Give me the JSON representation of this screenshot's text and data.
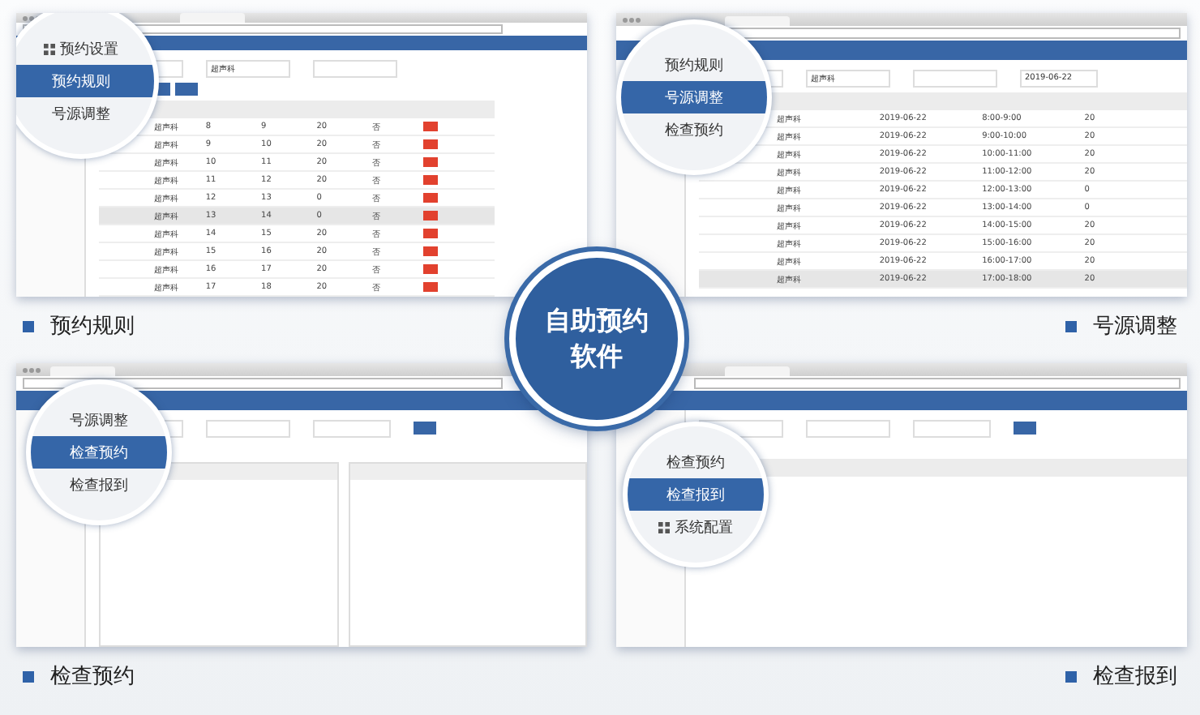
{
  "panels": [
    {
      "kind": "rules_table",
      "caption": "预约规则",
      "menu": [
        {
          "kind": "group",
          "label": "预约设置",
          "selected": false
        },
        {
          "kind": "item",
          "label": "预约规则",
          "selected": true
        },
        {
          "kind": "item",
          "label": "号源调整",
          "selected": false
        }
      ],
      "filters": [
        {
          "kind": "select"
        },
        {
          "kind": "select",
          "value": "超声科"
        },
        {
          "kind": "select"
        }
      ],
      "rows": [
        {
          "cells": [
            "超声科",
            "8",
            "9",
            "20",
            "否"
          ],
          "selected": false
        },
        {
          "cells": [
            "超声科",
            "9",
            "10",
            "20",
            "否"
          ],
          "selected": false
        },
        {
          "cells": [
            "超声科",
            "10",
            "11",
            "20",
            "否"
          ],
          "selected": false
        },
        {
          "cells": [
            "超声科",
            "11",
            "12",
            "20",
            "否"
          ],
          "selected": false
        },
        {
          "cells": [
            "超声科",
            "12",
            "13",
            "0",
            "否"
          ],
          "selected": false
        },
        {
          "cells": [
            "超声科",
            "13",
            "14",
            "0",
            "否"
          ],
          "selected": true
        },
        {
          "cells": [
            "超声科",
            "14",
            "15",
            "20",
            "否"
          ],
          "selected": false
        },
        {
          "cells": [
            "超声科",
            "15",
            "16",
            "20",
            "否"
          ],
          "selected": false
        },
        {
          "cells": [
            "超声科",
            "16",
            "17",
            "20",
            "否"
          ],
          "selected": false
        },
        {
          "cells": [
            "超声科",
            "17",
            "18",
            "20",
            "否"
          ],
          "selected": false
        }
      ]
    },
    {
      "kind": "slot_table",
      "caption": "号源调整",
      "menu": [
        {
          "kind": "item",
          "label": "预约规则",
          "selected": false
        },
        {
          "kind": "item",
          "label": "号源调整",
          "selected": true
        },
        {
          "kind": "item",
          "label": "检查预约",
          "selected": false
        }
      ],
      "filters": [
        {
          "kind": "select"
        },
        {
          "kind": "select",
          "value": "超声科"
        },
        {
          "kind": "select"
        },
        {
          "kind": "input",
          "value": "2019-06-22"
        }
      ],
      "rows": [
        {
          "cells": [
            "超声科",
            "2019-06-22",
            "8:00-9:00",
            "20"
          ],
          "selected": false
        },
        {
          "cells": [
            "超声科",
            "2019-06-22",
            "9:00-10:00",
            "20"
          ],
          "selected": false
        },
        {
          "cells": [
            "超声科",
            "2019-06-22",
            "10:00-11:00",
            "20"
          ],
          "selected": false
        },
        {
          "cells": [
            "超声科",
            "2019-06-22",
            "11:00-12:00",
            "20"
          ],
          "selected": false
        },
        {
          "cells": [
            "超声科",
            "2019-06-22",
            "12:00-13:00",
            "0"
          ],
          "selected": false
        },
        {
          "cells": [
            "超声科",
            "2019-06-22",
            "13:00-14:00",
            "0"
          ],
          "selected": false
        },
        {
          "cells": [
            "超声科",
            "2019-06-22",
            "14:00-15:00",
            "20"
          ],
          "selected": false
        },
        {
          "cells": [
            "超声科",
            "2019-06-22",
            "15:00-16:00",
            "20"
          ],
          "selected": false
        },
        {
          "cells": [
            "超声科",
            "2019-06-22",
            "16:00-17:00",
            "20"
          ],
          "selected": false
        },
        {
          "cells": [
            "超声科",
            "2019-06-22",
            "17:00-18:00",
            "20"
          ],
          "selected": true
        }
      ]
    },
    {
      "kind": "split",
      "caption": "检查预约",
      "menu": [
        {
          "kind": "item",
          "label": "号源调整",
          "selected": false
        },
        {
          "kind": "item",
          "label": "检查预约",
          "selected": true
        },
        {
          "kind": "item",
          "label": "检查报到",
          "selected": false
        }
      ],
      "filters": [
        {
          "kind": "select"
        },
        {
          "kind": "select"
        },
        {
          "kind": "input"
        },
        {
          "kind": "button"
        }
      ]
    },
    {
      "kind": "list",
      "caption": "检查报到",
      "menu": [
        {
          "kind": "item",
          "label": "检查预约",
          "selected": false
        },
        {
          "kind": "item",
          "label": "检查报到",
          "selected": true
        },
        {
          "kind": "group",
          "label": "系统配置",
          "selected": false
        }
      ],
      "filters": [
        {
          "kind": "select"
        },
        {
          "kind": "select"
        },
        {
          "kind": "input"
        },
        {
          "kind": "button"
        }
      ]
    }
  ],
  "badge": {
    "title": "自助预约软件"
  }
}
